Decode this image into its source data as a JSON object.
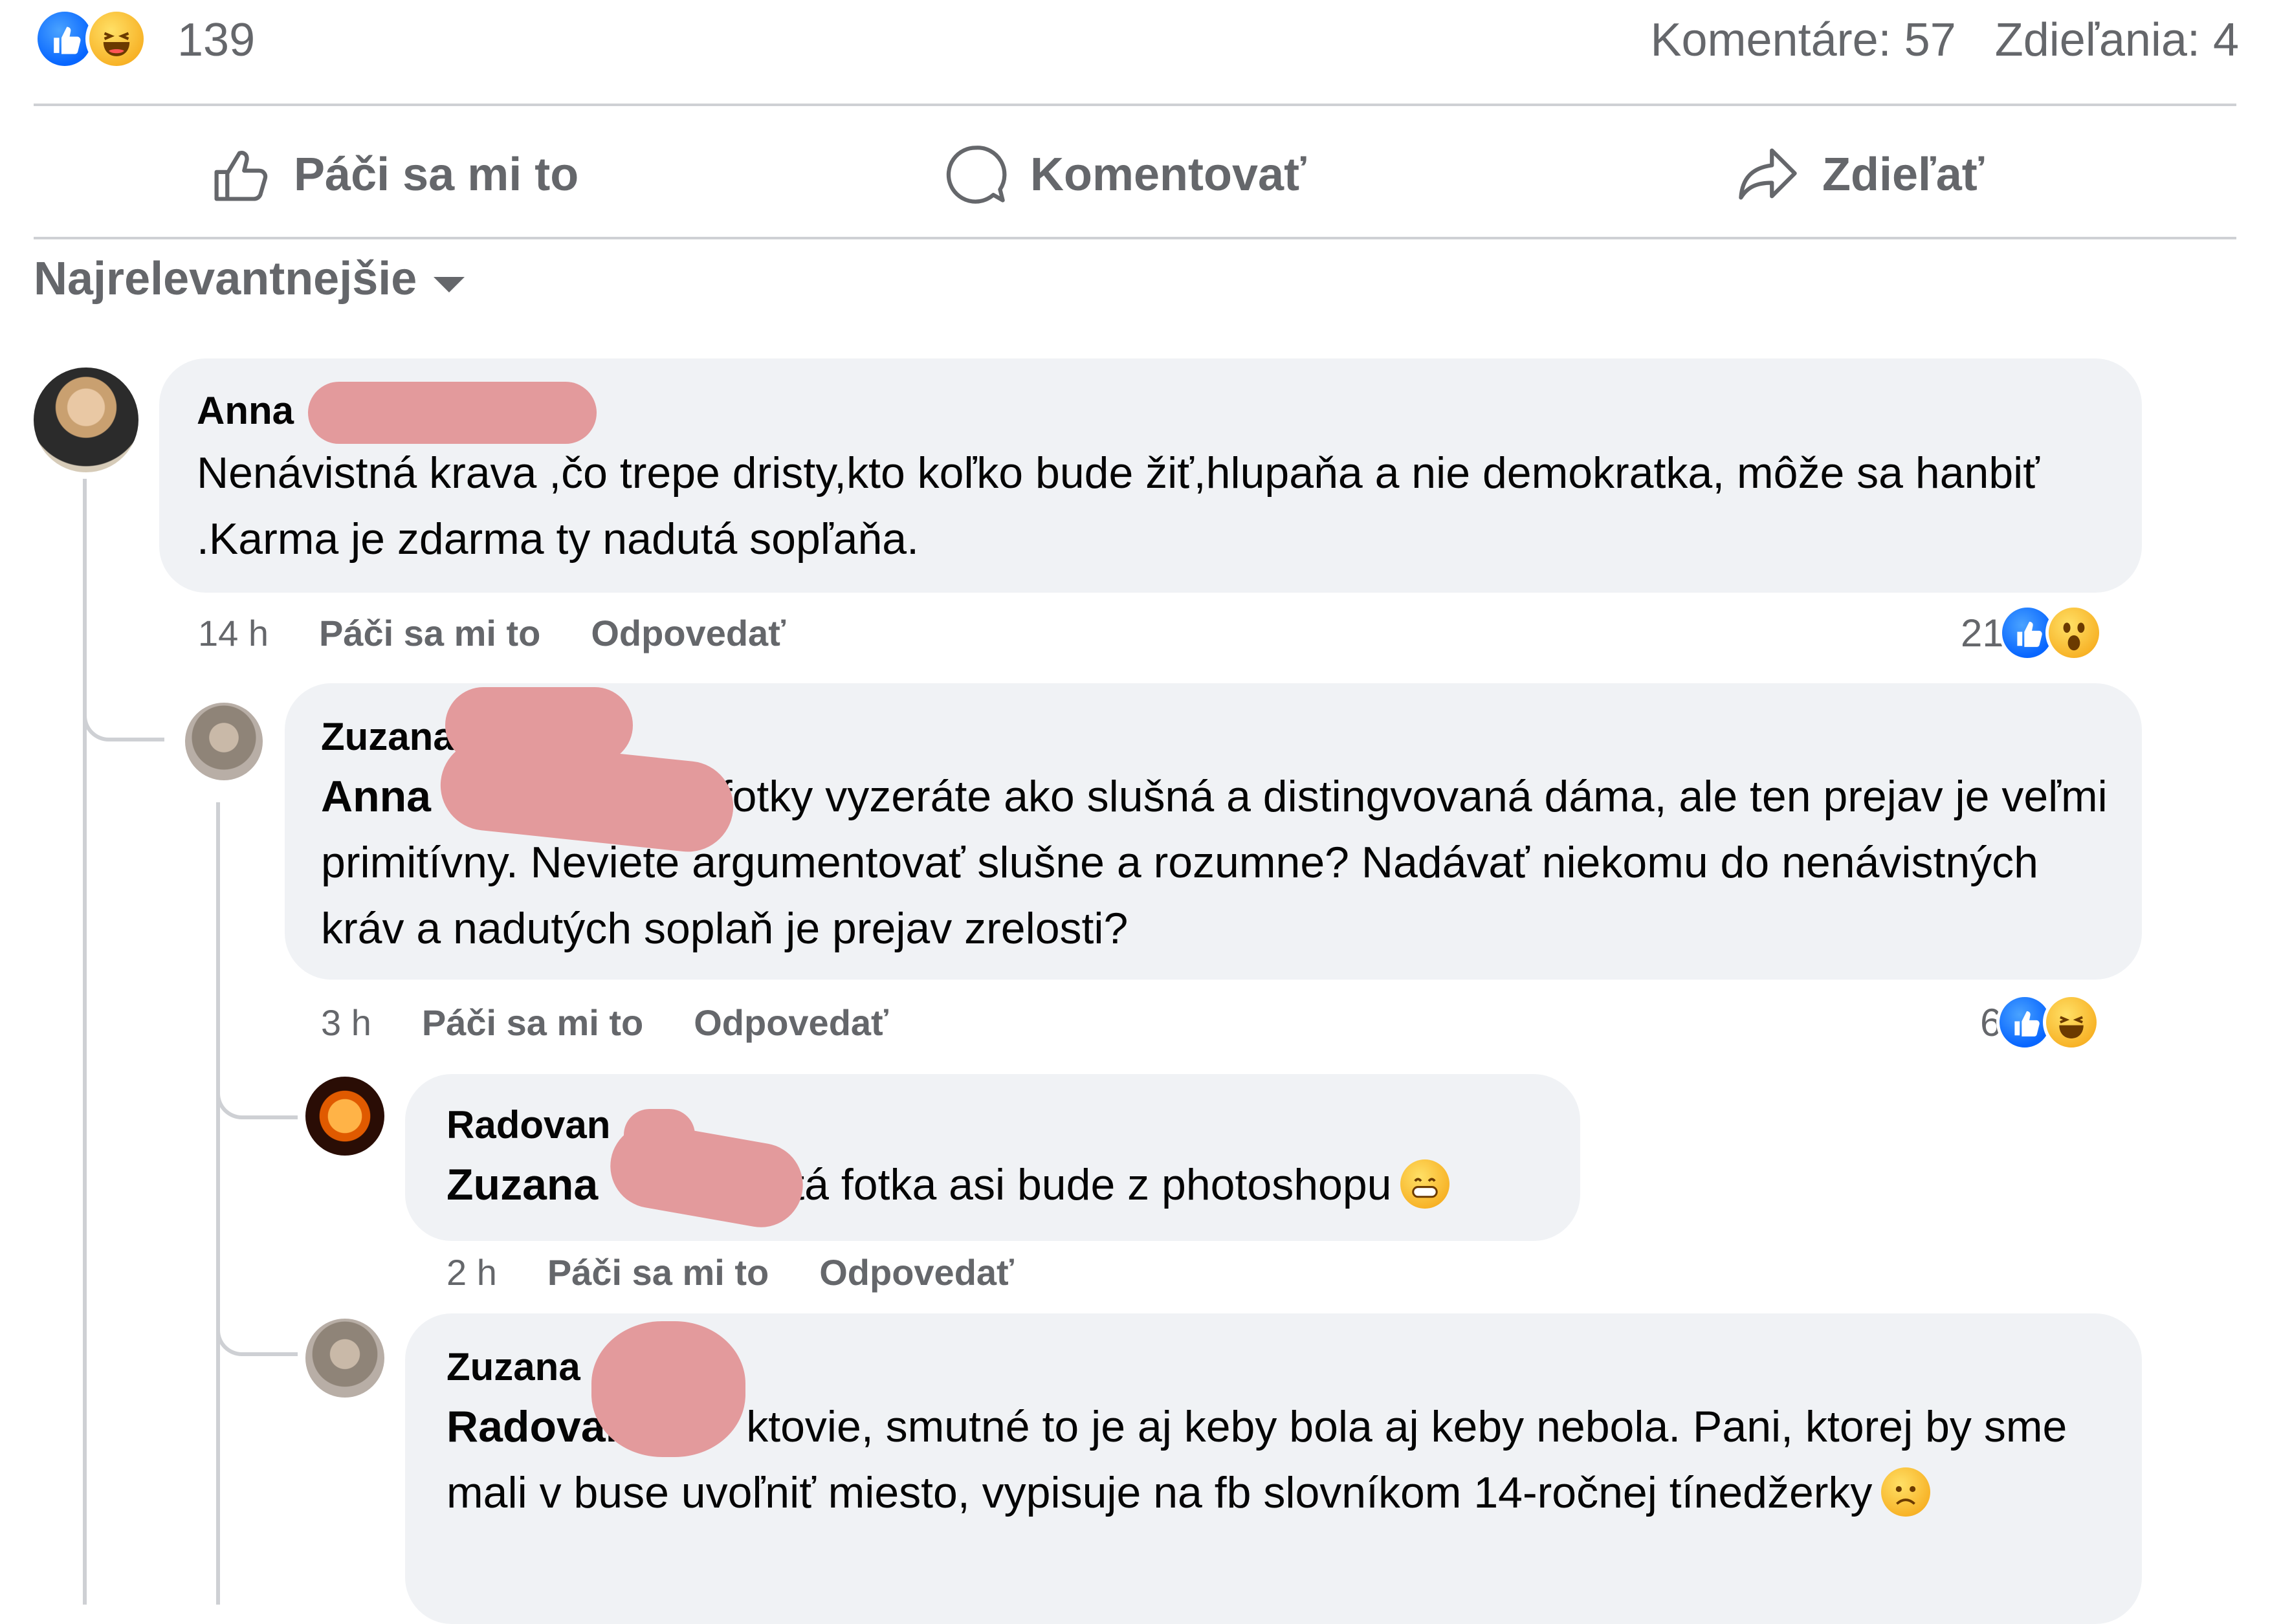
{
  "post_stats": {
    "reactions_count": "139",
    "reaction_icons": [
      "like-icon",
      "haha-icon"
    ],
    "comments": "Komentáre: 57",
    "shares": "Zdieľania: 4"
  },
  "actions": {
    "like": "Páči sa mi to",
    "comment": "Komentovať",
    "share": "Zdieľať"
  },
  "sort": {
    "label": "Najrelevantnejšie"
  },
  "comments": [
    {
      "author": "Anna",
      "text": "Nenávistná krava ,čo trepe dristy,kto koľko bude žiť,hlupaňa a nie demokratka, môže sa hanbiť .Karma je zdarma ty nadutá sopľaňa.",
      "time": "14 h",
      "like": "Páči sa mi to",
      "reply": "Odpovedať",
      "reactions_count": "21",
      "reaction_icons": [
        "like-icon",
        "wow-icon"
      ]
    },
    {
      "author": "Zuzana",
      "mention": "Anna",
      "text": "ä podľa fotky vyzeráte ako slušná a distingvovaná dáma, ale ten prejav je veľmi primitívny. Neviete argumentovať slušne a rozumne? Nadávať niekomu do nenávistných kráv a nadutých soplaň je prejav zrelosti?",
      "time": "3 h",
      "like": "Páči sa mi to",
      "reply": "Odpovedať",
      "reactions_count": "6",
      "reaction_icons": [
        "like-icon",
        "haha-icon"
      ]
    },
    {
      "author": "Radovan",
      "mention": "Zuzana",
      "text": "tá fotka asi bude z photoshopu",
      "emoji": "grin-emoji",
      "time": "2 h",
      "like": "Páči sa mi to",
      "reply": "Odpovedať"
    },
    {
      "author": "Zuzana",
      "mention": "Radovan",
      "text": "ktovie, smutné to je aj keby bola aj keby nebola. Pani, ktorej by sme mali v buse uvoľniť miesto, vypisuje na fb slovníkom 14-ročnej tínedžerky",
      "emoji": "frown-emoji"
    }
  ],
  "colors": {
    "like_blue": "#0866ff",
    "haha_yellow": "#f7b125",
    "bubble": "#f0f2f5",
    "muted_text": "#65676b",
    "divider": "#ced0d4",
    "redaction": "#e39a9c"
  }
}
